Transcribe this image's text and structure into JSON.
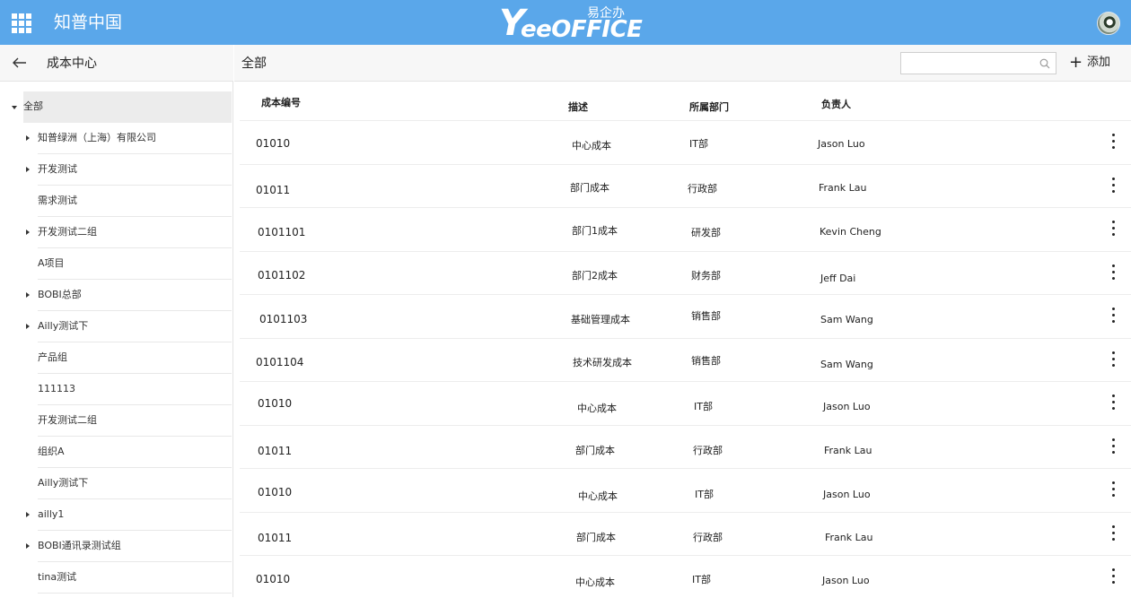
{
  "topbar": {
    "app_title": "知普中国",
    "logo_mark": "Y",
    "logo_text": "eeOFFICE",
    "logo_cn": "易企办",
    "icons": [
      "apps-grid-icon",
      "avatar"
    ]
  },
  "sidebar": {
    "title": "成本中心",
    "back_icon": "arrow-left-icon",
    "tree": [
      {
        "label": "全部",
        "expanded": true,
        "has_children": true,
        "root": true
      },
      {
        "label": "知普绿洲（上海）有限公司",
        "has_children": true
      },
      {
        "label": "开发测试",
        "has_children": true
      },
      {
        "label": "需求测试",
        "has_children": false
      },
      {
        "label": "开发测试二组",
        "has_children": true
      },
      {
        "label": "A项目",
        "has_children": false
      },
      {
        "label": "BOBI总部",
        "has_children": true
      },
      {
        "label": "Ailly测试下",
        "has_children": true
      },
      {
        "label": "产品组",
        "has_children": false
      },
      {
        "label": "111113",
        "has_children": false
      },
      {
        "label": "开发测试二组",
        "has_children": false
      },
      {
        "label": "组织A",
        "has_children": false
      },
      {
        "label": "Ailly测试下",
        "has_children": false
      },
      {
        "label": "ailly1",
        "has_children": true
      },
      {
        "label": "BOBI通讯录测试组",
        "has_children": true
      },
      {
        "label": "tina测试",
        "has_children": false
      }
    ]
  },
  "main": {
    "title": "全部",
    "search": {
      "placeholder": "",
      "value": ""
    },
    "add_label": "添加",
    "columns": [
      "成本编号",
      "描述",
      "所属部门",
      "负责人"
    ],
    "rows": [
      {
        "code": "01010",
        "desc": "中心成本",
        "dept": "IT部",
        "owner": "Jason Luo"
      },
      {
        "code": "01011",
        "desc": "部门成本",
        "dept": "行政部",
        "owner": "Frank Lau"
      },
      {
        "code": "0101101",
        "desc": "部门1成本",
        "dept": "研发部",
        "owner": "Kevin Cheng"
      },
      {
        "code": "0101102",
        "desc": "部门2成本",
        "dept": "财务部",
        "owner": "Jeff Dai"
      },
      {
        "code": "0101103",
        "desc": "基础管理成本",
        "dept": "销售部",
        "owner": "Sam Wang"
      },
      {
        "code": "0101104",
        "desc": "技术研发成本",
        "dept": "销售部",
        "owner": "Sam Wang"
      },
      {
        "code": "01010",
        "desc": "中心成本",
        "dept": "IT部",
        "owner": "Jason Luo"
      },
      {
        "code": "01011",
        "desc": "部门成本",
        "dept": "行政部",
        "owner": "Frank Lau"
      },
      {
        "code": "01010",
        "desc": "中心成本",
        "dept": "IT部",
        "owner": "Jason Luo"
      },
      {
        "code": "01011",
        "desc": "部门成本",
        "dept": "行政部",
        "owner": "Frank Lau"
      },
      {
        "code": "01010",
        "desc": "中心成本",
        "dept": "IT部",
        "owner": "Jason Luo"
      }
    ]
  },
  "colors": {
    "topbar": "#5aa7ea",
    "header_bg": "#f7f7f7",
    "selected_bg": "#ececec"
  }
}
